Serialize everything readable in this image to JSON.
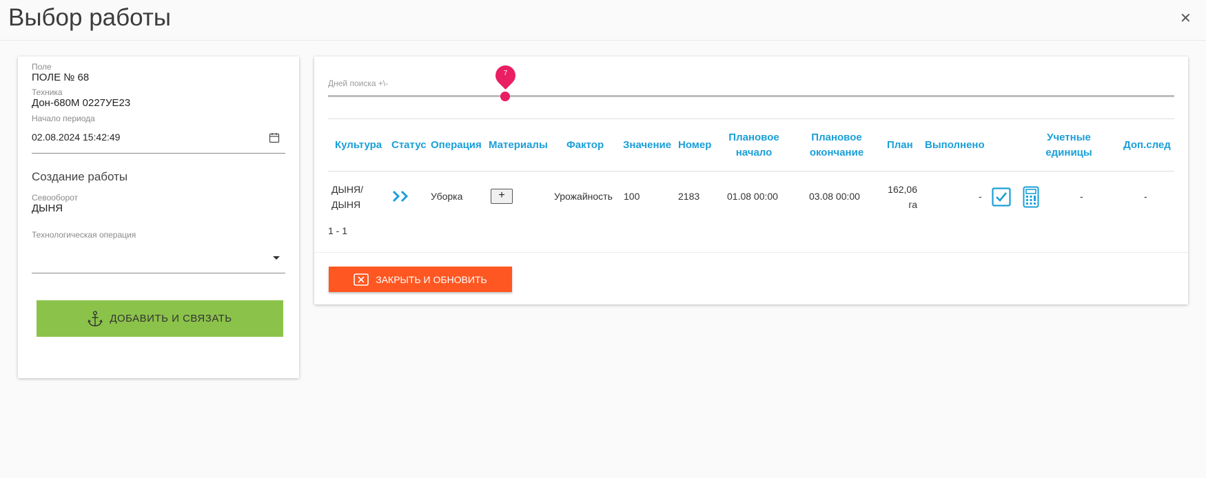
{
  "dialog": {
    "title": "Выбор работы",
    "close_icon": "close-icon"
  },
  "left": {
    "field_label": "Поле",
    "field_value": "ПОЛЕ № 68",
    "tech_label": "Техника",
    "tech_value": "Дон-680М 0227УЕ23",
    "period_label": "Начало периода",
    "period_value": "02.08.2024 15:42:49",
    "section_title": "Создание работы",
    "rotation_label": "Севооборот",
    "rotation_value": "ДЫНЯ",
    "operation_label": "Технологическая операция",
    "operation_value": "",
    "add_button": "ДОБАВИТЬ И СВЯЗАТЬ",
    "add_button_color": "#8bc34a"
  },
  "slider": {
    "label": "Дней поиска +\\-",
    "value": "7",
    "accent": "#e91e63"
  },
  "table": {
    "header_color": "#1a9fd8",
    "headers": {
      "culture": "Культура",
      "status": "Статус",
      "operation": "Операция",
      "materials": "Материалы",
      "factor": "Фактор",
      "value": "Значение",
      "number": "Номер",
      "plan_start_1": "Плановое",
      "plan_start_2": "начало",
      "plan_end_1": "Плановое",
      "plan_end_2": "окончание",
      "plan": "План",
      "done": "Выполнено",
      "units_1": "Учетные",
      "units_2": "единицы",
      "extra": "Доп.след"
    },
    "row": {
      "culture_1": "ДЫНЯ/",
      "culture_2": "ДЫНЯ",
      "status_icon": "double-chevron-right-icon",
      "operation": "Уборка",
      "materials_add": "+",
      "factor": "Урожайность",
      "value": "100",
      "number": "2183",
      "plan_start": "01.08 00:00",
      "plan_end": "03.08 00:00",
      "plan_1": "162,06",
      "plan_2": "га",
      "done": "-",
      "units": "-",
      "extra": "-"
    },
    "pagination": "1 - 1"
  },
  "footer": {
    "close_button": "ЗАКРЫТЬ И ОБНОВИТЬ",
    "close_button_color": "#ff5722"
  }
}
